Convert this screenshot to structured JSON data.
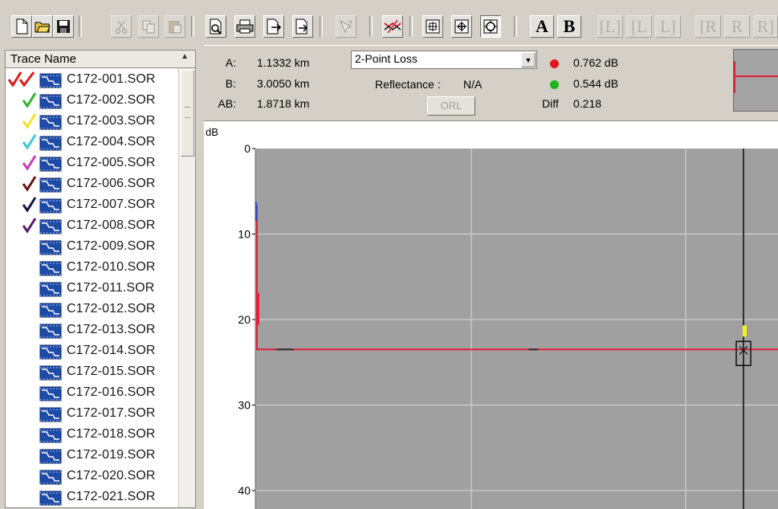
{
  "toolbar": {
    "buttons": [
      {
        "name": "new-file-icon",
        "x": 0
      },
      {
        "name": "open-folder-icon",
        "x": 0
      },
      {
        "name": "save-icon",
        "x": 0
      }
    ],
    "letter_a": "A",
    "letter_b": "B",
    "l_buttons": [
      "[L]",
      "[L",
      "L]"
    ],
    "r_buttons": [
      "[R",
      "R",
      "R]"
    ]
  },
  "trace_list": {
    "header": "Trace Name",
    "items": [
      {
        "label": "C172-001.SOR",
        "check_color": "#e01818",
        "double": true
      },
      {
        "label": "C172-002.SOR",
        "check_color": "#2fb52f"
      },
      {
        "label": "C172-003.SOR",
        "check_color": "#f2e12a"
      },
      {
        "label": "C172-004.SOR",
        "check_color": "#3fc8d8"
      },
      {
        "label": "C172-005.SOR",
        "check_color": "#c83cb4"
      },
      {
        "label": "C172-006.SOR",
        "check_color": "#6a1414"
      },
      {
        "label": "C172-007.SOR",
        "check_color": "#12164a"
      },
      {
        "label": "C172-008.SOR",
        "check_color": "#5a1c6e"
      },
      {
        "label": "C172-009.SOR"
      },
      {
        "label": "C172-010.SOR"
      },
      {
        "label": "C172-011.SOR"
      },
      {
        "label": "C172-012.SOR"
      },
      {
        "label": "C172-013.SOR"
      },
      {
        "label": "C172-014.SOR"
      },
      {
        "label": "C172-015.SOR"
      },
      {
        "label": "C172-016.SOR"
      },
      {
        "label": "C172-017.SOR"
      },
      {
        "label": "C172-018.SOR"
      },
      {
        "label": "C172-019.SOR"
      },
      {
        "label": "C172-020.SOR"
      },
      {
        "label": "C172-021.SOR"
      }
    ]
  },
  "info": {
    "a_label": "A:",
    "a_value": "1.1332 km",
    "b_label": "B:",
    "b_value": "3.0050 km",
    "ab_label": "AB:",
    "ab_value": "1.8718 km",
    "mode": "2-Point Loss",
    "reflectance_label": "Reflectance :",
    "reflectance_value": "N/A",
    "orl_button": "ORL",
    "loss_a": "0.762 dB",
    "loss_b": "0.544 dB",
    "diff_label": "Diff",
    "diff_value": "0.218",
    "loss_a_color": "#e0141c",
    "loss_b_color": "#1fb21f"
  },
  "chart_data": {
    "type": "line",
    "ylabel": "dB",
    "yticks": [
      "0",
      "10",
      "20",
      "30",
      "40"
    ],
    "ylim": [
      0,
      41
    ],
    "yreversed": true,
    "trace_color": "#e0203c",
    "trace_level_db": 23.5,
    "cursor_color": "#303030",
    "grid": true,
    "background": "#a0a0a0"
  }
}
